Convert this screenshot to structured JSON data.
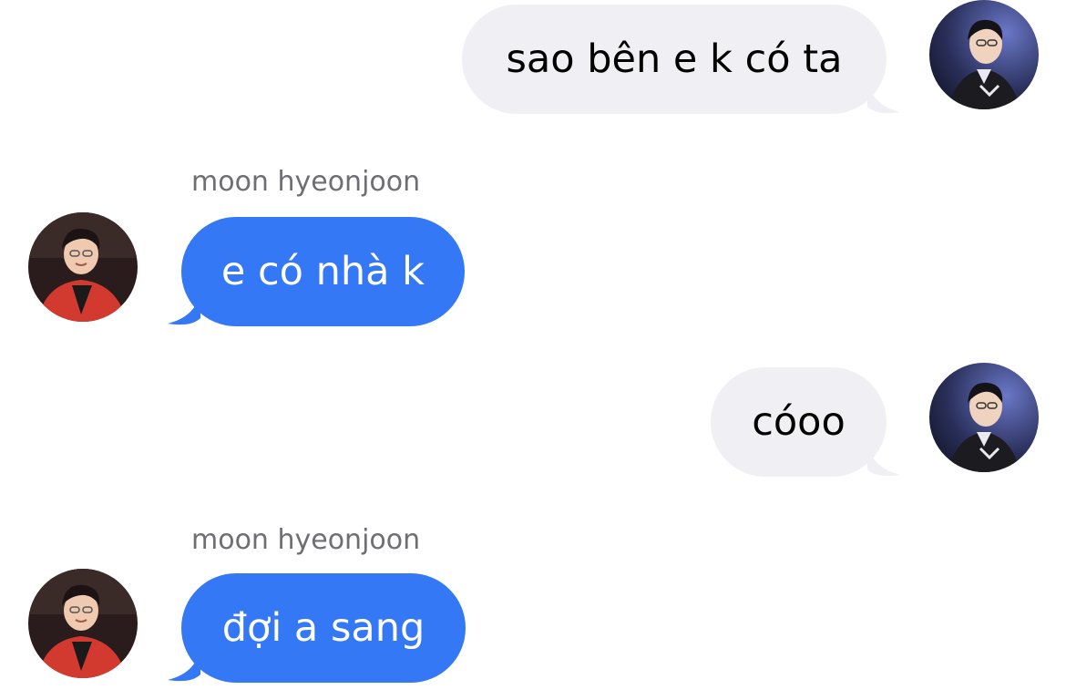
{
  "conversation": {
    "messages": [
      {
        "direction": "outgoing",
        "text": "sao bên e k có ta",
        "avatar_icon": "user-avatar-icon"
      },
      {
        "direction": "incoming",
        "sender": "moon hyeonjoon",
        "text": "e có nhà k",
        "avatar_icon": "contact-avatar-icon"
      },
      {
        "direction": "outgoing",
        "text": "cóoo",
        "avatar_icon": "user-avatar-icon"
      },
      {
        "direction": "incoming",
        "sender": "moon hyeonjoon",
        "text": "đợi a sang",
        "avatar_icon": "contact-avatar-icon"
      }
    ]
  },
  "colors": {
    "outgoing_bubble": "#efeff4",
    "incoming_bubble": "#3478f6",
    "sender_label": "#6e6e73",
    "background": "#ffffff"
  }
}
